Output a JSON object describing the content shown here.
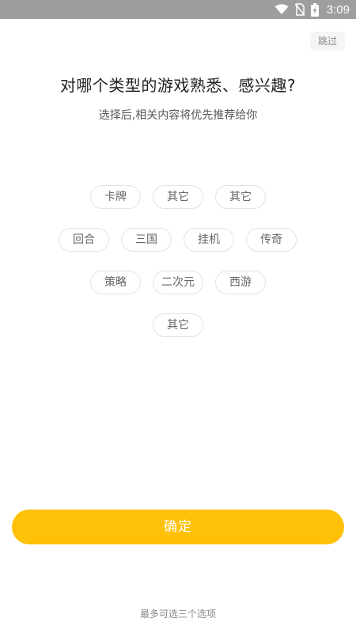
{
  "status_bar": {
    "time": "3:09",
    "icons": [
      "wifi-icon",
      "no-sim-icon",
      "battery-charging-icon"
    ]
  },
  "skip_label": "跳过",
  "title": "对哪个类型的游戏熟悉、感兴趣?",
  "subtitle": "选择后,相关内容将优先推荐给你",
  "tags": [
    "卡牌",
    "其它",
    "其它",
    "回合",
    "三国",
    "挂机",
    "传奇",
    "策略",
    "二次元",
    "西游",
    "其它"
  ],
  "confirm_label": "确定",
  "footer_hint": "最多可选三个选项",
  "colors": {
    "status_bar": "#9e9e9e",
    "accent": "#ffc107",
    "tag_border": "#e3e3e3",
    "tag_text": "#666666"
  }
}
